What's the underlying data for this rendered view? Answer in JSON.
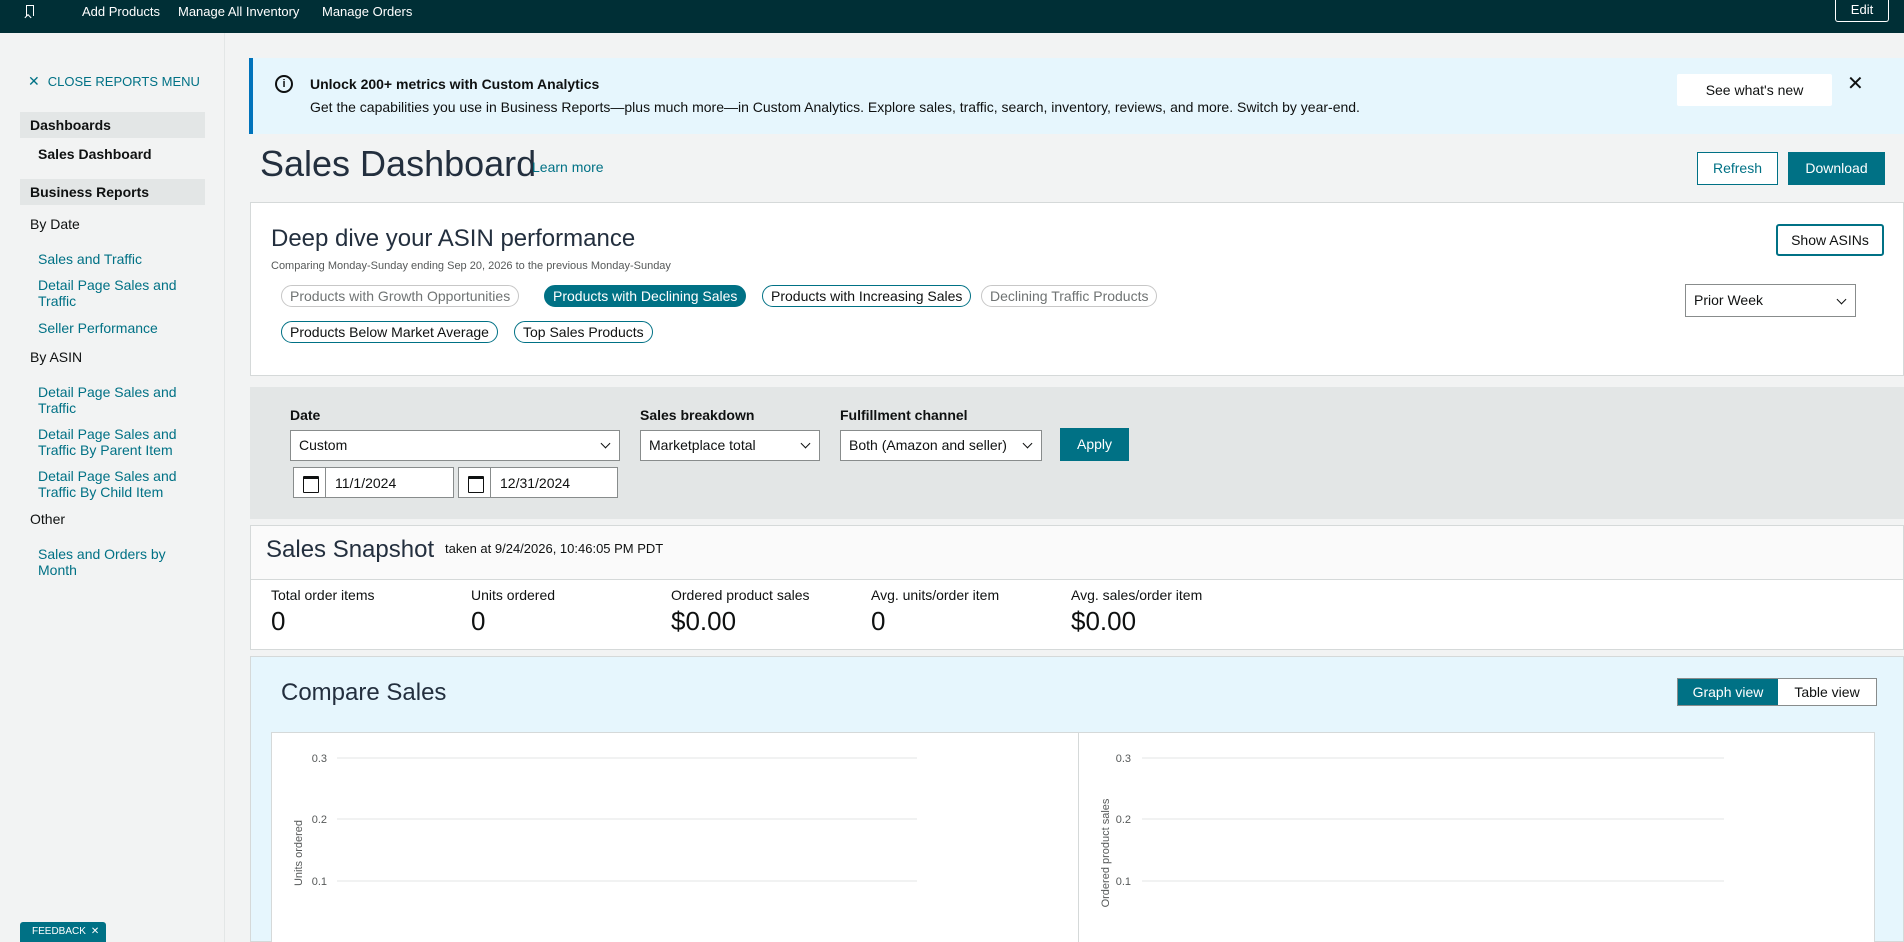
{
  "topnav": {
    "links": [
      "Add Products",
      "Manage All Inventory",
      "Manage Orders"
    ],
    "edit_label": "Edit"
  },
  "sidebar": {
    "close_label": "CLOSE REPORTS MENU",
    "dashboards_heading": "Dashboards",
    "sales_dashboard": "Sales Dashboard",
    "business_reports_heading": "Business Reports",
    "by_date": "By Date",
    "by_date_links": [
      "Sales and Traffic",
      "Detail Page Sales and Traffic",
      "Seller Performance"
    ],
    "by_asin": "By ASIN",
    "by_asin_links": [
      "Detail Page Sales and Traffic",
      "Detail Page Sales and Traffic By Parent Item",
      "Detail Page Sales and Traffic By Child Item"
    ],
    "other": "Other",
    "other_links": [
      "Sales and Orders by Month"
    ]
  },
  "feedback_label": "FEEDBACK",
  "banner": {
    "title": "Unlock 200+ metrics with Custom Analytics",
    "text": "Get the capabilities you use in Business Reports—plus much more—in Custom Analytics. Explore sales, traffic, search, inventory, reviews, and more. Switch by year-end.",
    "button": "See what's new"
  },
  "page": {
    "title": "Sales Dashboard",
    "learn_more": "Learn more",
    "refresh": "Refresh",
    "download": "Download"
  },
  "asin": {
    "title": "Deep dive your ASIN performance",
    "subtitle": "Comparing Monday-Sunday ending Sep 20, 2026 to the previous Monday-Sunday",
    "pills": [
      "Products with Growth Opportunities",
      "Products with Declining Sales",
      "Products with Increasing Sales",
      "Declining Traffic Products",
      "Products Below Market Average",
      "Top Sales Products"
    ],
    "show_asins": "Show ASINs",
    "period": "Prior Week"
  },
  "filters": {
    "date_label": "Date",
    "date_value": "Custom",
    "start_date": "11/1/2024",
    "end_date": "12/31/2024",
    "breakdown_label": "Sales breakdown",
    "breakdown_value": "Marketplace total",
    "fulfillment_label": "Fulfillment channel",
    "fulfillment_value": "Both (Amazon and seller)",
    "apply": "Apply"
  },
  "snapshot": {
    "title": "Sales Snapshot",
    "taken_at": "taken at 9/24/2026, 10:46:05 PM PDT",
    "metrics": [
      {
        "label": "Total order items",
        "value": "0"
      },
      {
        "label": "Units ordered",
        "value": "0"
      },
      {
        "label": "Ordered product sales",
        "value": "$0.00"
      },
      {
        "label": "Avg. units/order item",
        "value": "0"
      },
      {
        "label": "Avg. sales/order item",
        "value": "$0.00"
      }
    ]
  },
  "compare": {
    "title": "Compare Sales",
    "graph_view": "Graph view",
    "table_view": "Table view"
  },
  "chart_data": [
    {
      "type": "line",
      "ylabel": "Units ordered",
      "yticks": [
        "0.3",
        "0.2",
        "0.1"
      ],
      "series": []
    },
    {
      "type": "line",
      "ylabel": "Ordered product sales",
      "yticks": [
        "0.3",
        "0.2",
        "0.1"
      ],
      "series": []
    }
  ]
}
